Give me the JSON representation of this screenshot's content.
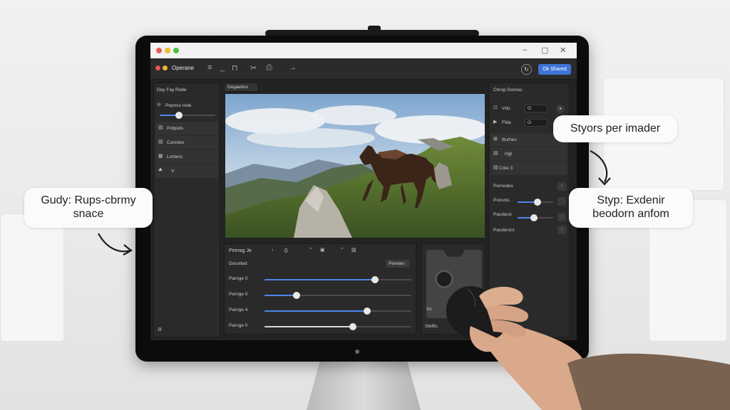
{
  "window": {
    "app_name": "Operane",
    "controls": [
      "–",
      "▢",
      "✕"
    ]
  },
  "toolbar": {
    "tools": [
      "≡",
      "_",
      "⊓",
      "✂",
      "⎙",
      "→"
    ],
    "share_label": "Ok Shared",
    "round_icon": "↻"
  },
  "left_panel": {
    "title": "Dey Fay Robe",
    "slider_label": "Pepnso Inde",
    "slider_value": 0.35,
    "items": [
      {
        "icon": "▤",
        "label": "Potpiols"
      },
      {
        "icon": "▤",
        "label": "Conotes"
      },
      {
        "icon": "▦",
        "label": "Lorbers"
      },
      {
        "icon": "⛰",
        "label": "V"
      }
    ]
  },
  "canvas": {
    "tab_label": "Degaelins"
  },
  "right_panel": {
    "title": "Chrop Gomes",
    "rows": [
      {
        "icon": "⊡",
        "label": "Vdo",
        "value": "O"
      },
      {
        "icon": "▶",
        "label": "Ffde",
        "value": "O"
      },
      {
        "icon": "⊠",
        "label": "Burhes"
      },
      {
        "icon": "▤",
        "label": "Hgt"
      },
      {
        "icon": "▤",
        "label": "Cote 3"
      }
    ],
    "group_label": "Pernodes",
    "sliders": [
      {
        "label": "Poxsnis",
        "value": 0.55
      },
      {
        "label": "Pacdaroi",
        "value": 0.45
      },
      {
        "label": "Pacdersnt",
        "value": 0
      }
    ]
  },
  "adjust_panel": {
    "title": "Pirerag Je",
    "counter_value": "0",
    "section_label": "Dosstted",
    "section_button": "Pereteo",
    "sliders": [
      {
        "label": "Parnge 0",
        "value": 0.75
      },
      {
        "label": "Pernge 0",
        "value": 0.22
      },
      {
        "label": "Parnge 4",
        "value": 0.7
      },
      {
        "label": "Parnge 0",
        "value": 0.6
      }
    ]
  },
  "nav_panel": {
    "footer_label": "Stelfis",
    "icon_label": "Vo"
  },
  "annotations": {
    "left_line1": "Gudy: Rups-cbrmy",
    "left_line2": "snace",
    "right_top": "Styors per imader",
    "right_mid_line1": "Styp: Exdenir",
    "right_mid_line2": "beodorn anfom"
  },
  "colors": {
    "accent": "#3f74d6",
    "panel_bg": "#2a2a2a"
  }
}
